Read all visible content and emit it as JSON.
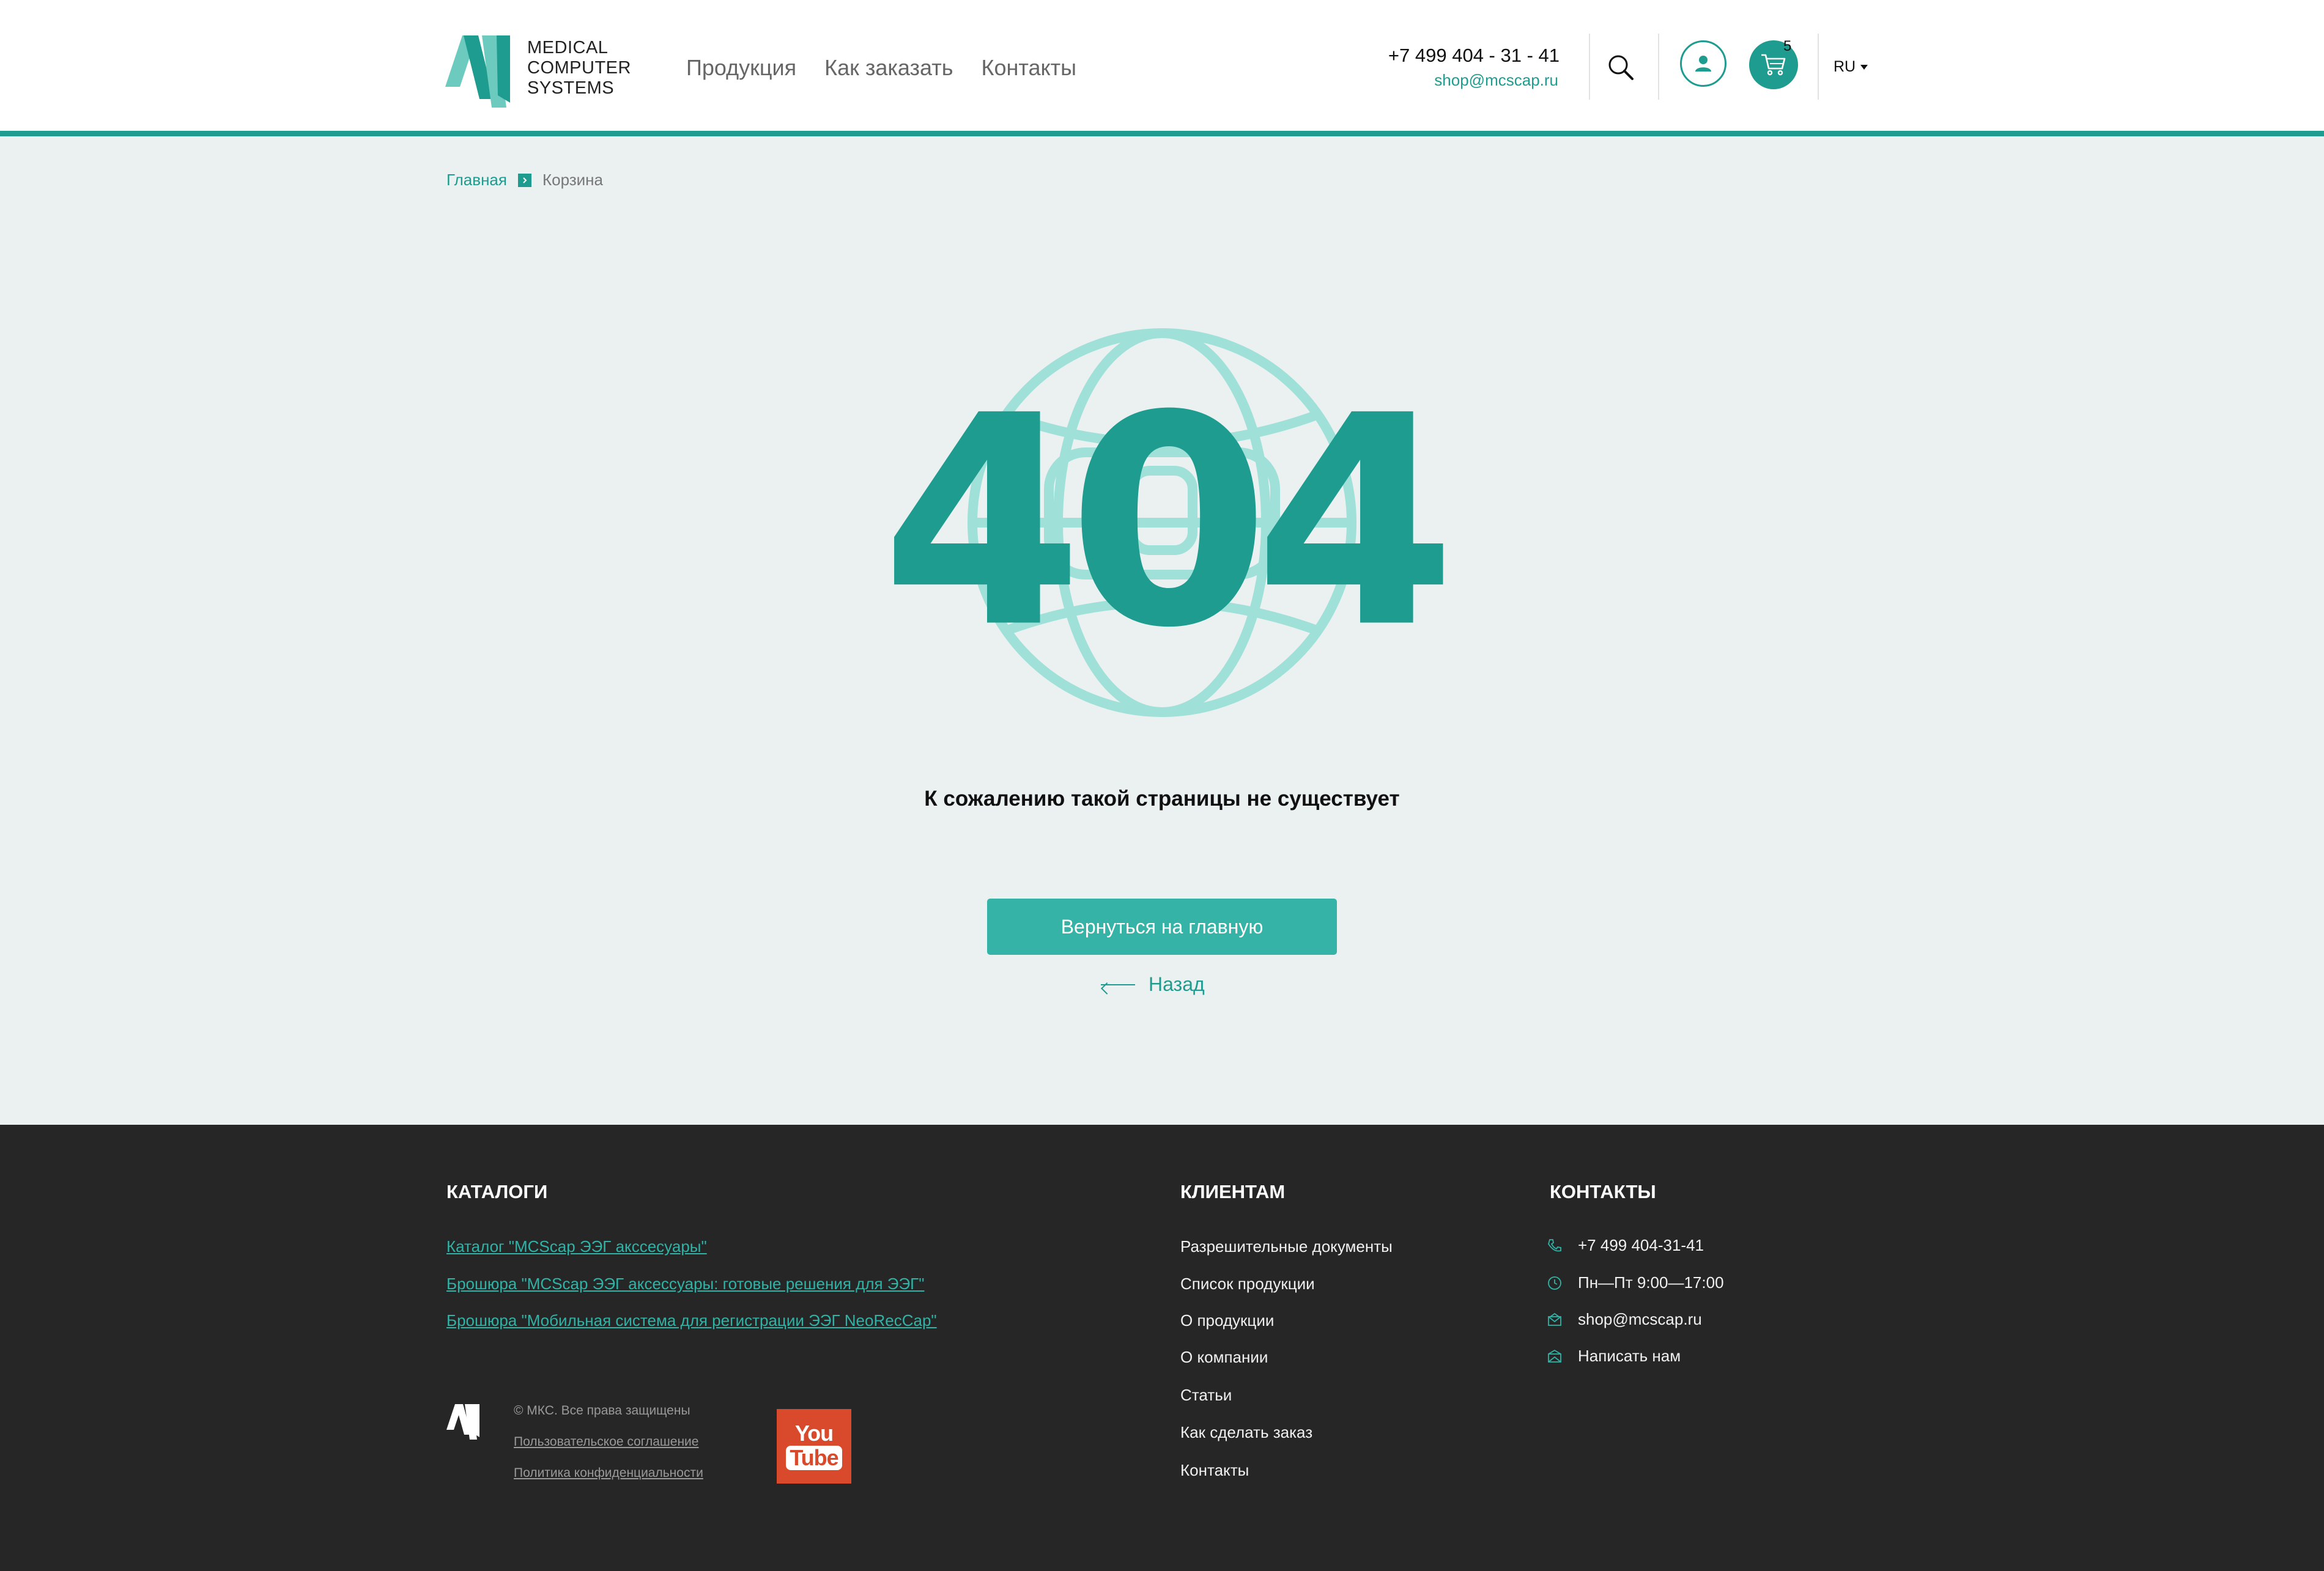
{
  "brand": {
    "logo_lines": [
      "MEDICAL",
      "COMPUTER",
      "SYSTEMS"
    ],
    "accent_color": "#1e9c8f",
    "button_color": "#35b3a6"
  },
  "header": {
    "nav": [
      "Продукция",
      "Как заказать",
      "Контакты"
    ],
    "phone": "+7 499 404 - 31 - 41",
    "email": "shop@mcscap.ru",
    "cart_count": "5",
    "language": "RU",
    "icons": [
      "search-icon",
      "user-icon",
      "cart-icon"
    ]
  },
  "breadcrumb": {
    "home": "Главная",
    "current": "Корзина"
  },
  "error": {
    "code": "404",
    "message": "К сожалению такой страницы не существует",
    "home_button": "Вернуться на главную",
    "back_link": "Назад"
  },
  "footer": {
    "catalogs": {
      "title": "КАТАЛОГИ",
      "links": [
        "Каталог \"MCScap ЭЭГ акссесуары\"",
        "Брошюра \"MCScap ЭЭГ аксессуары: готовые решения для ЭЭГ\"",
        "Брошюра \"Мобильная система для регистрации ЭЭГ NeoRecCap\""
      ]
    },
    "clients": {
      "title": "КЛИЕНТАМ",
      "links": [
        "Разрешительные документы",
        "Список продукции",
        "О продукции",
        "О компании",
        "Статьи",
        "Как сделать заказ",
        "Контакты"
      ]
    },
    "contacts": {
      "title": "КОНТАКТЫ",
      "items": [
        {
          "icon": "phone-icon",
          "text": "+7 499 404-31-41"
        },
        {
          "icon": "clock-icon",
          "text": "Пн—Пт 9:00—17:00"
        },
        {
          "icon": "mail-icon",
          "text": "shop@mcscap.ru"
        },
        {
          "icon": "mail-open-icon",
          "text": "Написать нам"
        }
      ]
    },
    "copyright": "© МКС. Все права защищены",
    "legal": [
      "Пользовательское соглашение",
      "Политика конфиденциальности"
    ],
    "youtube": {
      "top": "You",
      "bottom": "Tube"
    }
  }
}
